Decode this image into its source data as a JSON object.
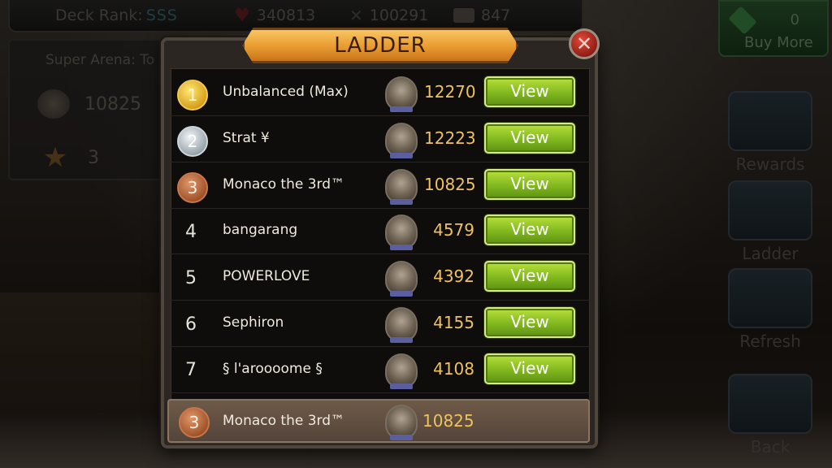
{
  "topbar": {
    "rank_label": "Deck Rank:",
    "rank_value": "SSS",
    "health": "340813",
    "attack": "100291",
    "cards": "847"
  },
  "left_panel": {
    "title": "Super Arena: To",
    "power": "10825",
    "stars": "3"
  },
  "side_menu": {
    "gems": "0",
    "buy_more": "Buy More",
    "rewards": "Rewards",
    "ladder": "Ladder",
    "refresh": "Refresh",
    "back": "Back"
  },
  "modal": {
    "title": "LADDER",
    "close_glyph": "✕",
    "view_label": "View"
  },
  "ladder": [
    {
      "rank": "1",
      "name": "Unbalanced (Max)",
      "score": "12270"
    },
    {
      "rank": "2",
      "name": "Strat ¥",
      "score": "12223"
    },
    {
      "rank": "3",
      "name": "Monaco the 3rd™",
      "score": "10825"
    },
    {
      "rank": "4",
      "name": "bangarang",
      "score": "4579"
    },
    {
      "rank": "5",
      "name": "POWERLOVE",
      "score": "4392"
    },
    {
      "rank": "6",
      "name": "Sephiron",
      "score": "4155"
    },
    {
      "rank": "7",
      "name": "§ l'aroooome §",
      "score": "4108"
    }
  ],
  "current_player": {
    "rank": "3",
    "name": "Monaco the 3rd™",
    "score": "10825"
  },
  "colors": {
    "gold_score": "#efc260",
    "view_button": "#80b81e",
    "banner": "#e89a2e"
  }
}
